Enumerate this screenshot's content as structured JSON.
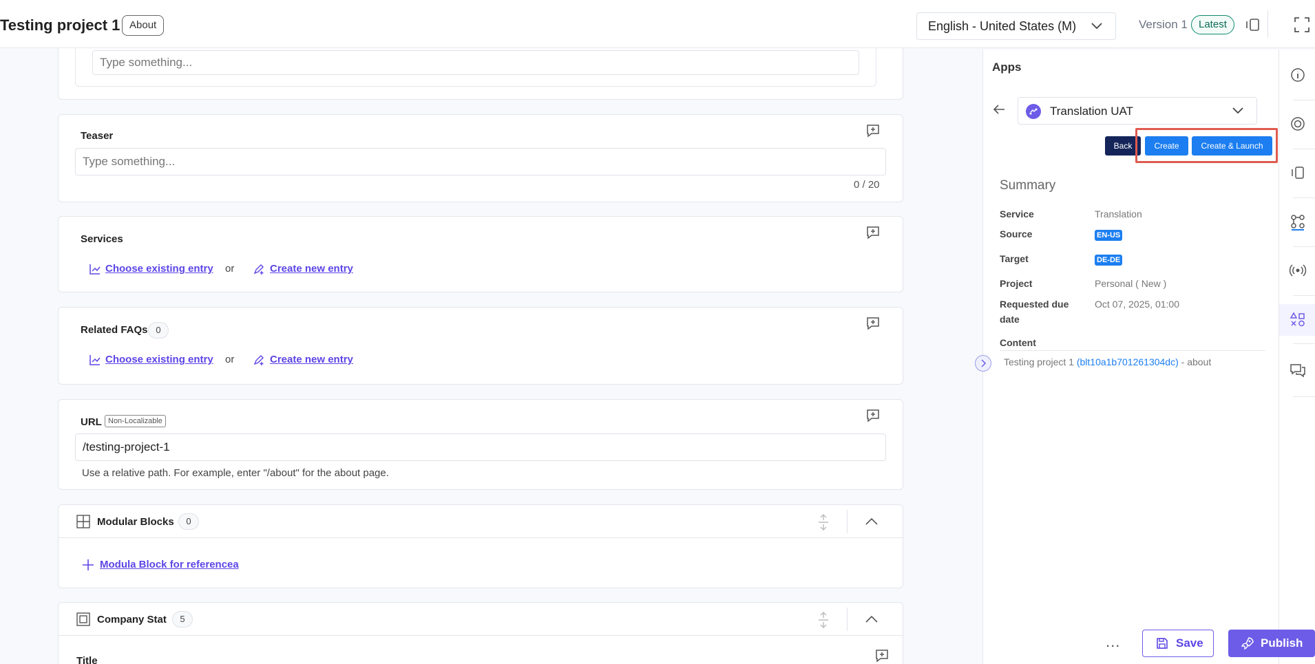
{
  "header": {
    "entry_title": "Testing project 1",
    "about_chip": "About",
    "locale": "English - United States (M)",
    "version": "Version 1",
    "latest_badge": "Latest",
    "icons": [
      "compare-icon",
      "fullscreen-icon"
    ]
  },
  "fields": {
    "top_placeholder": "Type something...",
    "teaser": {
      "label": "Teaser",
      "placeholder": "Type something...",
      "counter": "0 / 20"
    },
    "services": {
      "label": "Services",
      "choose_label": "Choose existing entry",
      "or_text": "or",
      "create_label": "Create new entry"
    },
    "related_faqs": {
      "label": "Related FAQs",
      "count": "0",
      "choose_label": "Choose existing entry",
      "or_text": "or",
      "create_label": "Create new entry"
    },
    "url": {
      "label": "URL",
      "badge": "Non-Localizable",
      "value": "/testing-project-1",
      "help": "Use a relative path. For example, enter \"/about\" for the about page."
    },
    "modular_blocks": {
      "label": "Modular Blocks",
      "count": "0",
      "add_label": "Modula Block for referencea"
    },
    "company_stat": {
      "label": "Company Stat",
      "count": "5",
      "sub_label": "Title"
    }
  },
  "panel": {
    "title": "Apps",
    "app_name": "Translation UAT",
    "buttons": {
      "back": "Back",
      "create": "Create",
      "create_launch": "Create & Launch"
    },
    "summary_title": "Summary",
    "summary": {
      "service_key": "Service",
      "service_val": "Translation",
      "source_key": "Source",
      "source_val": "EN-US",
      "target_key": "Target",
      "target_val": "DE-DE",
      "project_key": "Project",
      "project_val": "Personal ( New )",
      "due_key": "Requested due date",
      "due_val": "Oct 07, 2025, 01:00",
      "content_key": "Content",
      "content_title": "Testing project 1",
      "content_uid": "(blt10a1b701261304dc)",
      "content_suffix": "- about"
    }
  },
  "rail_icons": [
    "info-icon",
    "target-icon",
    "compare-icon",
    "workflow-icon",
    "broadcast-icon",
    "apps-icon",
    "chat-icon"
  ],
  "footer": {
    "more": "...",
    "save": "Save",
    "publish": "Publish"
  },
  "colors": {
    "accent": "#6c5ce7",
    "primary_blue": "#1c7ef0",
    "dark_navy": "#15255a",
    "highlight": "#e05a4f",
    "latest_green": "#0e8a6e"
  }
}
